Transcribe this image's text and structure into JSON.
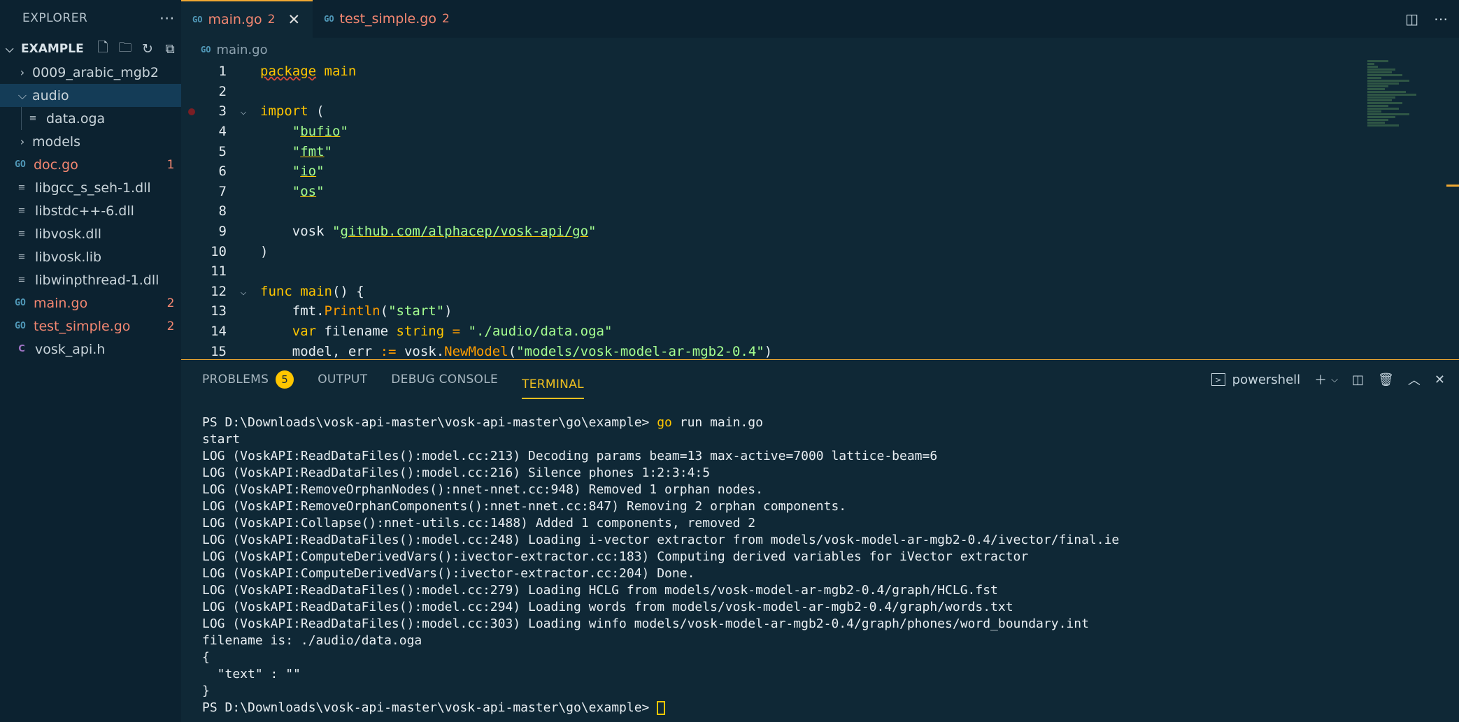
{
  "sidebar": {
    "title": "EXPLORER",
    "more_icon": "more-icon",
    "folder_name": "EXAMPLE",
    "items": [
      {
        "label": "0009_arabic_mgb2",
        "kind": "folder",
        "expanded": false,
        "badge": ""
      },
      {
        "label": "audio",
        "kind": "folder",
        "expanded": true,
        "badge": ""
      },
      {
        "label": "data.oga",
        "kind": "file",
        "badge": ""
      },
      {
        "label": "models",
        "kind": "folder",
        "expanded": false,
        "badge": ""
      },
      {
        "label": "doc.go",
        "kind": "go",
        "badge": "1"
      },
      {
        "label": "libgcc_s_seh-1.dll",
        "kind": "file",
        "badge": ""
      },
      {
        "label": "libstdc++-6.dll",
        "kind": "file",
        "badge": ""
      },
      {
        "label": "libvosk.dll",
        "kind": "file",
        "badge": ""
      },
      {
        "label": "libvosk.lib",
        "kind": "file",
        "badge": ""
      },
      {
        "label": "libwinpthread-1.dll",
        "kind": "file",
        "badge": ""
      },
      {
        "label": "main.go",
        "kind": "go",
        "badge": "2"
      },
      {
        "label": "test_simple.go",
        "kind": "go",
        "badge": "2"
      },
      {
        "label": "vosk_api.h",
        "kind": "c",
        "badge": ""
      }
    ]
  },
  "tabs": [
    {
      "label": "main.go",
      "count": "2",
      "active": true
    },
    {
      "label": "test_simple.go",
      "count": "2",
      "active": false
    }
  ],
  "breadcrumb": "main.go",
  "editor": {
    "line_numbers": [
      "1",
      "2",
      "3",
      "4",
      "5",
      "6",
      "7",
      "8",
      "9",
      "10",
      "11",
      "12",
      "13",
      "14",
      "15"
    ]
  },
  "panel": {
    "tabs": [
      "PROBLEMS",
      "OUTPUT",
      "DEBUG CONSOLE",
      "TERMINAL"
    ],
    "problems_count": "5",
    "active_tab": "TERMINAL",
    "shell": "powershell"
  },
  "terminal": {
    "prompt": "PS D:\\Downloads\\vosk-api-master\\vosk-api-master\\go\\example> ",
    "command_go": "go",
    "command_rest": " run main.go",
    "lines": [
      "start",
      "LOG (VoskAPI:ReadDataFiles():model.cc:213) Decoding params beam=13 max-active=7000 lattice-beam=6",
      "LOG (VoskAPI:ReadDataFiles():model.cc:216) Silence phones 1:2:3:4:5",
      "LOG (VoskAPI:RemoveOrphanNodes():nnet-nnet.cc:948) Removed 1 orphan nodes.",
      "LOG (VoskAPI:RemoveOrphanComponents():nnet-nnet.cc:847) Removing 2 orphan components.",
      "LOG (VoskAPI:Collapse():nnet-utils.cc:1488) Added 1 components, removed 2",
      "LOG (VoskAPI:ReadDataFiles():model.cc:248) Loading i-vector extractor from models/vosk-model-ar-mgb2-0.4/ivector/final.ie",
      "LOG (VoskAPI:ComputeDerivedVars():ivector-extractor.cc:183) Computing derived variables for iVector extractor",
      "LOG (VoskAPI:ComputeDerivedVars():ivector-extractor.cc:204) Done.",
      "LOG (VoskAPI:ReadDataFiles():model.cc:279) Loading HCLG from models/vosk-model-ar-mgb2-0.4/graph/HCLG.fst",
      "LOG (VoskAPI:ReadDataFiles():model.cc:294) Loading words from models/vosk-model-ar-mgb2-0.4/graph/words.txt",
      "LOG (VoskAPI:ReadDataFiles():model.cc:303) Loading winfo models/vosk-model-ar-mgb2-0.4/graph/phones/word_boundary.int",
      "filename is: ./audio/data.oga",
      "{",
      "  \"text\" : \"\"",
      "}"
    ],
    "final_prompt": "PS D:\\Downloads\\vosk-api-master\\vosk-api-master\\go\\example> "
  }
}
